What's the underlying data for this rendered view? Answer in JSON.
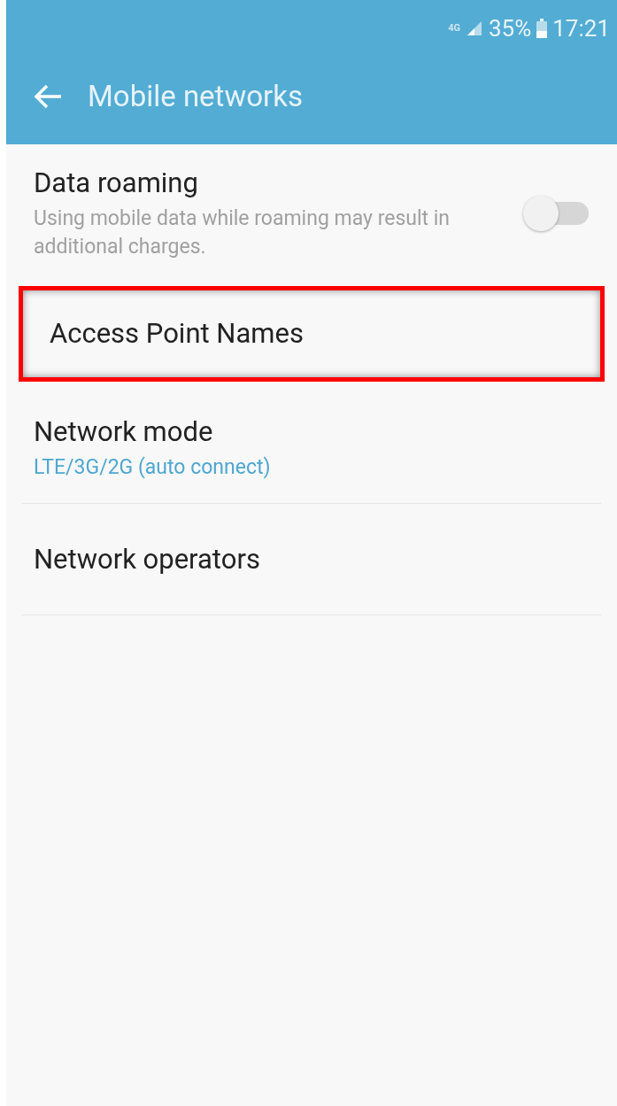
{
  "status_bar": {
    "network": "4G",
    "battery": "35%",
    "time": "17:21"
  },
  "header": {
    "title": "Mobile networks"
  },
  "settings": [
    {
      "kind": "toggle",
      "title": "Data roaming",
      "summary": "Using mobile data while roaming may result in additional charges.",
      "on": false,
      "highlighted": false
    },
    {
      "kind": "plain",
      "title": "Access Point Names",
      "highlighted": true
    },
    {
      "kind": "value",
      "title": "Network mode",
      "summary": "LTE/3G/2G (auto connect)",
      "highlighted": false
    },
    {
      "kind": "plain",
      "title": "Network operators",
      "highlighted": false
    }
  ]
}
